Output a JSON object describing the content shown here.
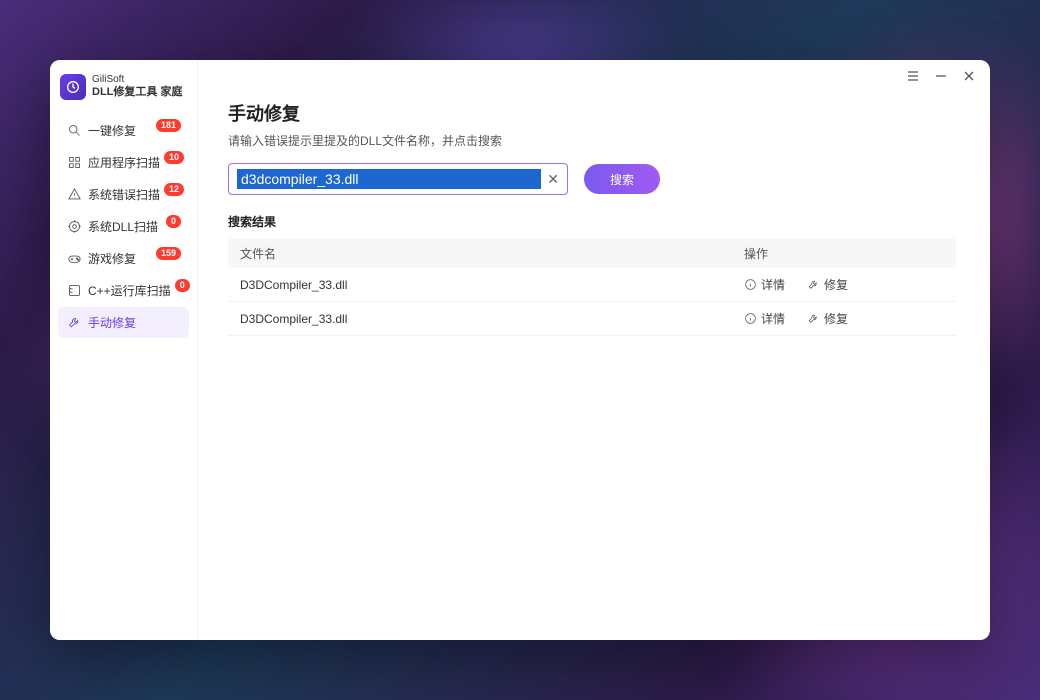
{
  "brand": {
    "line1": "GiliSoft",
    "line2": "DLL修复工具 家庭"
  },
  "titlebar": {
    "menu": "≡",
    "min": "—",
    "close": "✕"
  },
  "sidebar": {
    "items": [
      {
        "id": "one-click-repair",
        "label": "一键修复",
        "badge": "181",
        "icon": "magnify-gear"
      },
      {
        "id": "app-scan",
        "label": "应用程序扫描",
        "badge": "10",
        "icon": "grid-scan"
      },
      {
        "id": "sys-error-scan",
        "label": "系统错误扫描",
        "badge": "12",
        "icon": "warning-scan"
      },
      {
        "id": "sys-dll-scan",
        "label": "系统DLL扫描",
        "badge": "0",
        "icon": "target"
      },
      {
        "id": "game-repair",
        "label": "游戏修复",
        "badge": "159",
        "icon": "gamepad"
      },
      {
        "id": "cpp-runtime-scan",
        "label": "C++运行库扫描",
        "badge": "0",
        "icon": "cpp"
      },
      {
        "id": "manual-repair",
        "label": "手动修复",
        "badge": null,
        "icon": "tools",
        "active": true
      }
    ]
  },
  "main": {
    "title": "手动修复",
    "subtitle": "请输入错误提示里提及的DLL文件名称，并点击搜索",
    "search": {
      "value": "d3dcompiler_33.dll",
      "clear": "✕",
      "button": "搜索"
    },
    "results_label": "搜索结果",
    "table": {
      "headers": {
        "name": "文件名",
        "action": "操作"
      },
      "action_labels": {
        "detail": "详情",
        "repair": "修复"
      },
      "rows": [
        {
          "name": "D3DCompiler_33.dll"
        },
        {
          "name": "D3DCompiler_33.dll"
        }
      ]
    }
  }
}
